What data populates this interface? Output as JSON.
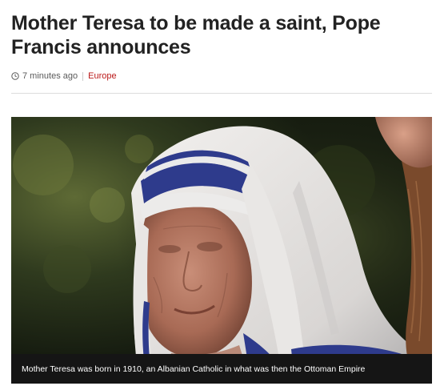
{
  "article": {
    "headline": "Mother Teresa to be made a saint, Pope Francis announces",
    "timestamp": "7 minutes ago",
    "section": "Europe",
    "accent_color": "#bb1919"
  },
  "media": {
    "caption": "Mother Teresa was born in 1910, an Albanian Catholic in what was then the Ottoman Empire"
  },
  "icons": {
    "timestamp_icon": "clock-icon"
  }
}
